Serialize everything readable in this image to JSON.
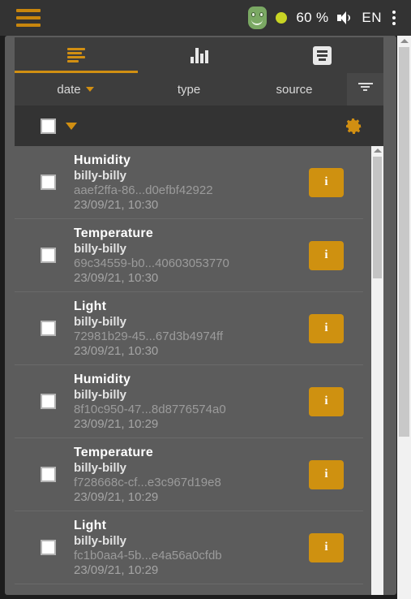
{
  "topbar": {
    "menu_icon": "hamburger-menu-icon",
    "avatar_icon": "green-face-avatar-icon",
    "status_icon": "status-dot-icon",
    "battery": "60 %",
    "volume_icon": "volume-icon",
    "language": "EN",
    "overflow_icon": "kebab-menu-icon"
  },
  "tabs": [
    {
      "id": "list",
      "icon": "list-icon",
      "active": true
    },
    {
      "id": "chart",
      "icon": "bar-chart-icon",
      "active": false
    },
    {
      "id": "article",
      "icon": "article-icon",
      "active": false
    }
  ],
  "columns": {
    "date": "date",
    "type": "type",
    "source": "source",
    "filter_icon": "filter-funnel-icon"
  },
  "selection_toolbar": {
    "select_all_checkbox": "unchecked",
    "dropdown_icon": "caret-down-icon",
    "settings_icon": "gear-icon"
  },
  "list": {
    "rows": [
      {
        "type": "Humidity",
        "source": "billy-billy",
        "id": "aaef2ffa-86...d0efbf42922",
        "date": "23/09/21, 10:30",
        "info_label": "i",
        "checked": false
      },
      {
        "type": "Temperature",
        "source": "billy-billy",
        "id": "69c34559-b0...40603053770",
        "date": "23/09/21, 10:30",
        "info_label": "i",
        "checked": false
      },
      {
        "type": "Light",
        "source": "billy-billy",
        "id": "72981b29-45...67d3b4974ff",
        "date": "23/09/21, 10:30",
        "info_label": "i",
        "checked": false
      },
      {
        "type": "Humidity",
        "source": "billy-billy",
        "id": "8f10c950-47...8d8776574a0",
        "date": "23/09/21, 10:29",
        "info_label": "i",
        "checked": false
      },
      {
        "type": "Temperature",
        "source": "billy-billy",
        "id": "f728668c-cf...e3c967d19e8",
        "date": "23/09/21, 10:29",
        "info_label": "i",
        "checked": false
      },
      {
        "type": "Light",
        "source": "billy-billy",
        "id": "fc1b0aa4-5b...e4a56a0cfdb",
        "date": "23/09/21, 10:29",
        "info_label": "i",
        "checked": false
      }
    ]
  },
  "colors": {
    "accent": "#d18f12",
    "info_button": "#cf9110",
    "topbar_bg": "#333333",
    "panel_bg": "#3d3d3d",
    "list_bg": "#5c5c5c",
    "status_dot": "#c8d424",
    "avatar": "#7aa863"
  }
}
